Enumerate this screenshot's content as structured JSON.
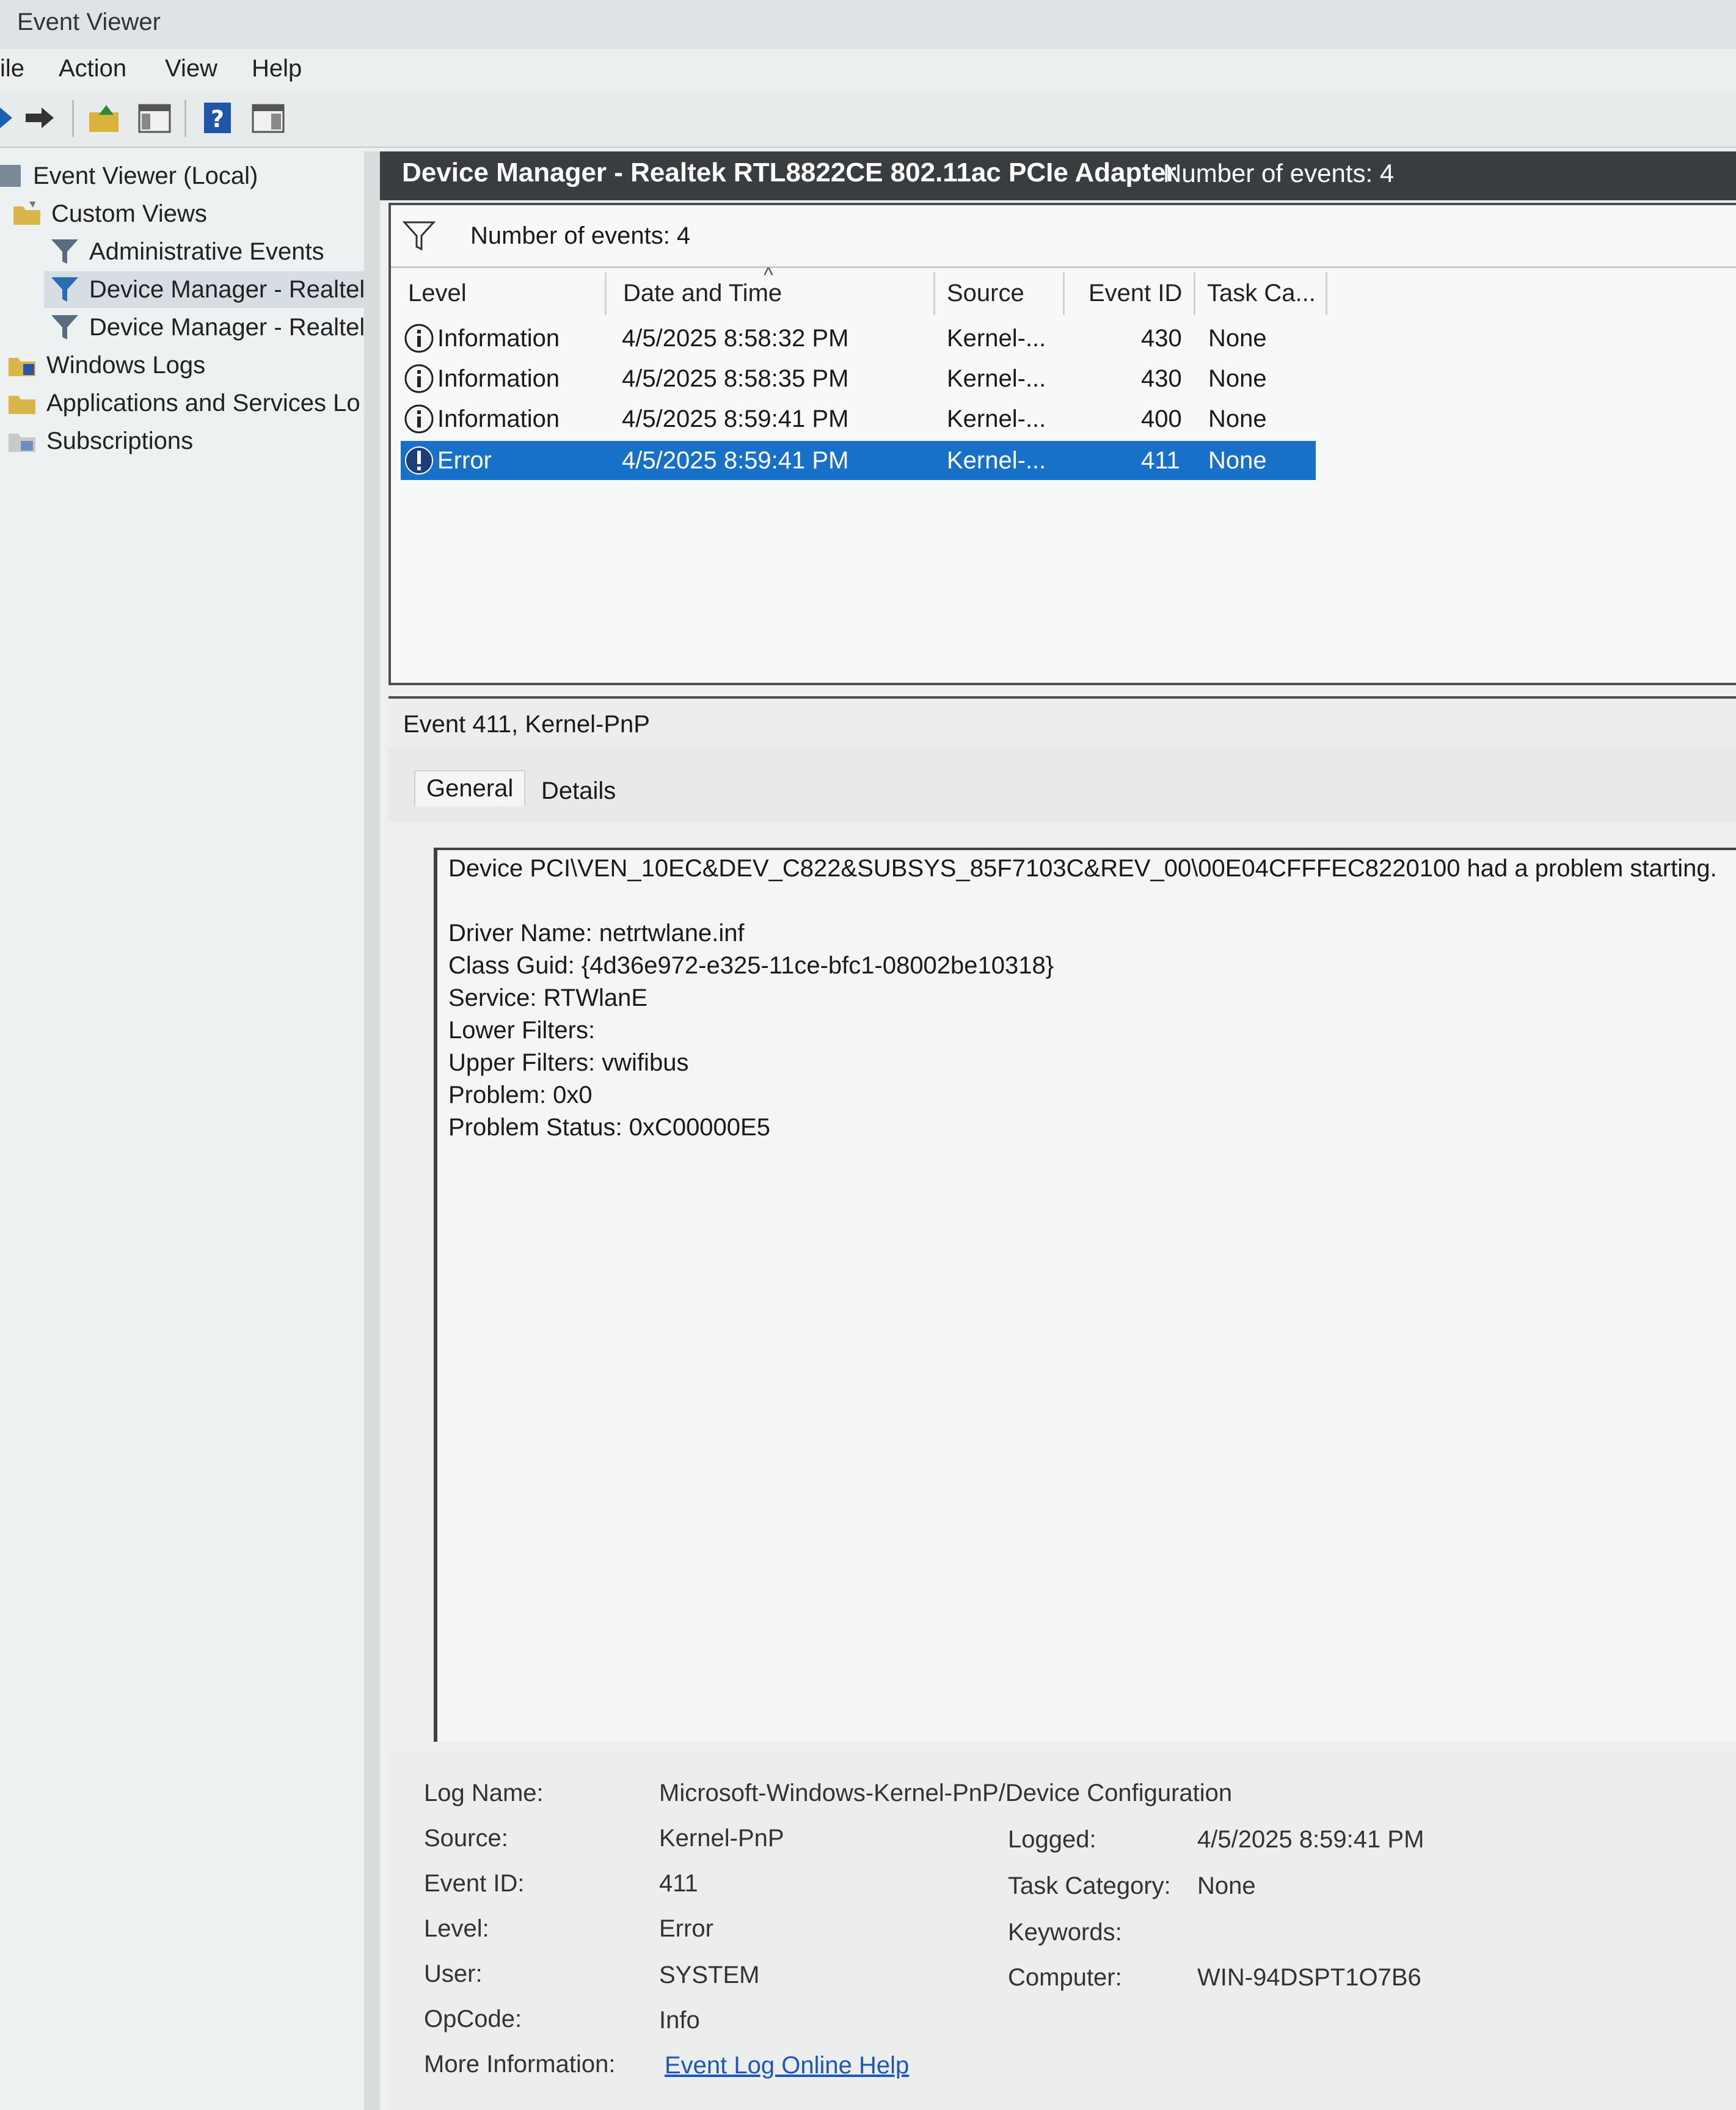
{
  "window": {
    "title": "Event Viewer"
  },
  "menu": [
    "ile",
    "Action",
    "View",
    "Help"
  ],
  "toolbar": {
    "icons": [
      "back-arrow-icon",
      "forward-arrow-icon",
      "folder-up-icon",
      "show-hide-pane-icon",
      "help-icon",
      "action-pane-icon"
    ]
  },
  "tree": {
    "items": [
      {
        "label": "Event Viewer (Local)",
        "icon": "event-viewer-icon"
      },
      {
        "label": "Custom Views",
        "icon": "folder-icon"
      },
      {
        "label": "Administrative Events",
        "icon": "filter-icon"
      },
      {
        "label": "Device Manager - Realtel",
        "icon": "filter-icon",
        "selected": true
      },
      {
        "label": "Device Manager - Realtel",
        "icon": "filter-icon"
      },
      {
        "label": "Windows Logs",
        "icon": "folder-icon"
      },
      {
        "label": "Applications and Services Lo",
        "icon": "folder-icon"
      },
      {
        "label": "Subscriptions",
        "icon": "subscriptions-icon"
      }
    ]
  },
  "pane": {
    "title": "Device Manager - Realtek RTL8822CE 802.11ac PCIe Adapter",
    "count": "Number of events: 4",
    "filter_text": "Number of events: 4"
  },
  "columns": [
    "Level",
    "Date and Time",
    "Source",
    "Event ID",
    "Task Ca..."
  ],
  "events": [
    {
      "level": "Information",
      "datetime": "4/5/2025 8:58:32 PM",
      "source": "Kernel-...",
      "id": "430",
      "task": "None"
    },
    {
      "level": "Information",
      "datetime": "4/5/2025 8:58:35 PM",
      "source": "Kernel-...",
      "id": "430",
      "task": "None"
    },
    {
      "level": "Information",
      "datetime": "4/5/2025 8:59:41 PM",
      "source": "Kernel-...",
      "id": "400",
      "task": "None"
    },
    {
      "level": "Error",
      "datetime": "4/5/2025 8:59:41 PM",
      "source": "Kernel-...",
      "id": "411",
      "task": "None"
    }
  ],
  "detail": {
    "header": "Event 411, Kernel-PnP",
    "tabs": [
      "General",
      "Details"
    ],
    "description": [
      "Device PCI\\VEN_10EC&DEV_C822&SUBSYS_85F7103C&REV_00\\00E04CFFFEC8220100 had a problem starting.",
      "",
      "Driver Name: netrtwlane.inf",
      "Class Guid: {4d36e972-e325-11ce-bfc1-08002be10318}",
      "Service: RTWlanE",
      "Lower Filters:",
      "Upper Filters: vwifibus",
      "Problem: 0x0",
      "Problem Status: 0xC00000E5"
    ],
    "props": {
      "log_name_label": "Log Name:",
      "log_name": "Microsoft-Windows-Kernel-PnP/Device Configuration",
      "source_label": "Source:",
      "source": "Kernel-PnP",
      "logged_label": "Logged:",
      "logged": "4/5/2025 8:59:41 PM",
      "event_id_label": "Event ID:",
      "event_id": "411",
      "task_cat_label": "Task Category:",
      "task_cat": "None",
      "level_label": "Level:",
      "level": "Error",
      "keywords_label": "Keywords:",
      "user_label": "User:",
      "user": "SYSTEM",
      "computer_label": "Computer:",
      "computer": "WIN-94DSPT1O7B6",
      "opcode_label": "OpCode:",
      "opcode": "Info",
      "more_info_label": "More Information:",
      "more_info_link": "Event Log Online Help"
    }
  },
  "colors": {
    "selection": "#1871c9",
    "pane_header": "#3a3d40",
    "link": "#1d57b8"
  }
}
